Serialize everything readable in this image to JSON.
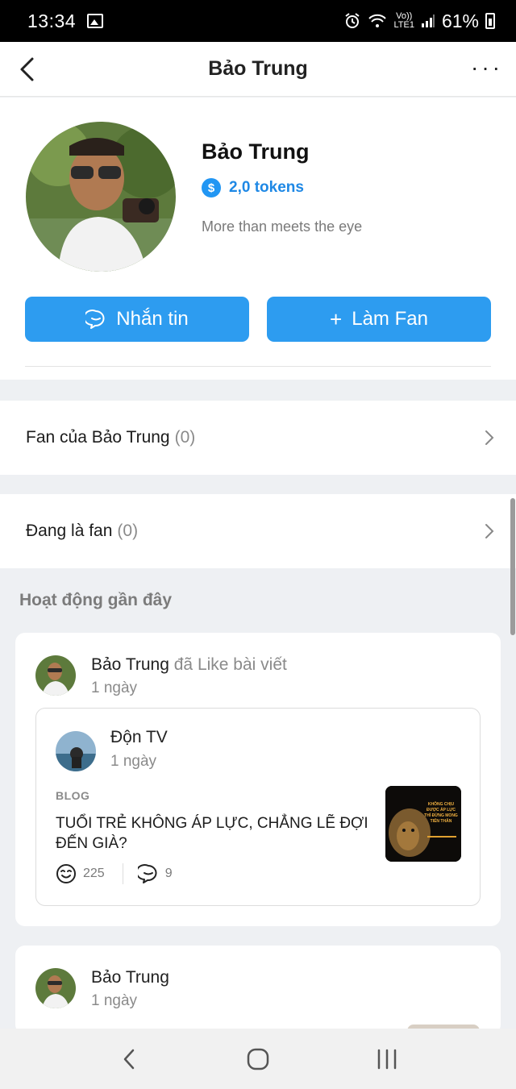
{
  "status_bar": {
    "time": "13:34",
    "network_small_top": "Vo))",
    "network_small_bottom": "LTE1",
    "battery_percent": "61%",
    "icons": [
      "image-icon",
      "alarm-icon",
      "wifi-icon",
      "signal-icon",
      "battery-icon"
    ]
  },
  "header": {
    "title": "Bảo Trung",
    "back_icon": "chevron-left-icon",
    "more_icon": "more-horizontal-icon"
  },
  "profile": {
    "name": "Bảo Trung",
    "tokens": "2,0 tokens",
    "coin_symbol": "$",
    "bio": "More than meets the eye",
    "message_button": "Nhắn tin",
    "fan_button": "Làm Fan",
    "fan_button_icon": "+"
  },
  "rows": {
    "fans_label": "Fan của Bảo Trung",
    "fans_count": "(0)",
    "following_label": "Đang là fan",
    "following_count": "(0)"
  },
  "activity": {
    "section_title": "Hoạt động gần đây",
    "items": [
      {
        "user": "Bảo Trung",
        "verb": "đã Like bài viết",
        "time": "1 ngày",
        "post": {
          "author": "Độn TV",
          "time": "1 ngày",
          "tag": "BLOG",
          "title": "TUỔI TRẺ KHÔNG ÁP LỰC, CHẲNG LẼ ĐỢI ĐẾN GIÀ?",
          "thumb_text": "KHÔNG CHỊU ĐƯỢC ÁP LỰC THÌ ĐỪNG MONG TIẾN THÂN",
          "likes": "225",
          "comments": "9"
        }
      },
      {
        "user": "Bảo Trung",
        "time": "1 ngày"
      }
    ]
  },
  "colors": {
    "accent": "#2d9cf0",
    "token_blue": "#1e88e5",
    "background": "#eef0f3"
  }
}
